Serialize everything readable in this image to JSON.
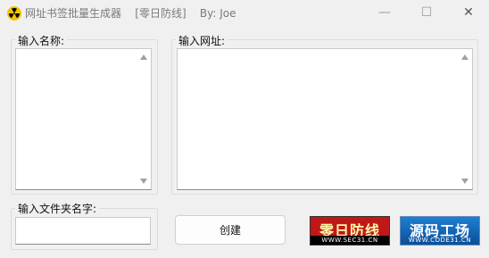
{
  "window": {
    "title": "网址书签批量生成器    [零日防线]    By: Joe",
    "minimize_glyph": "—",
    "maximize_glyph": "☐",
    "close_glyph": "✕"
  },
  "name_group": {
    "label": "输入名称:",
    "value": ""
  },
  "url_group": {
    "label": "输入网址:",
    "value": ""
  },
  "folder_group": {
    "label": "输入文件夹名字:",
    "value": ""
  },
  "create_button": {
    "label": "创建"
  },
  "banners": [
    {
      "title": "零日防线",
      "subtitle": "WWW.SEC31.CN"
    },
    {
      "title": "源码工场",
      "subtitle": "WWW.CODE31.CN"
    }
  ],
  "icons": {
    "app": "radiation-icon",
    "scroll_up": "arrow-up-icon",
    "scroll_down": "arrow-down-icon"
  }
}
